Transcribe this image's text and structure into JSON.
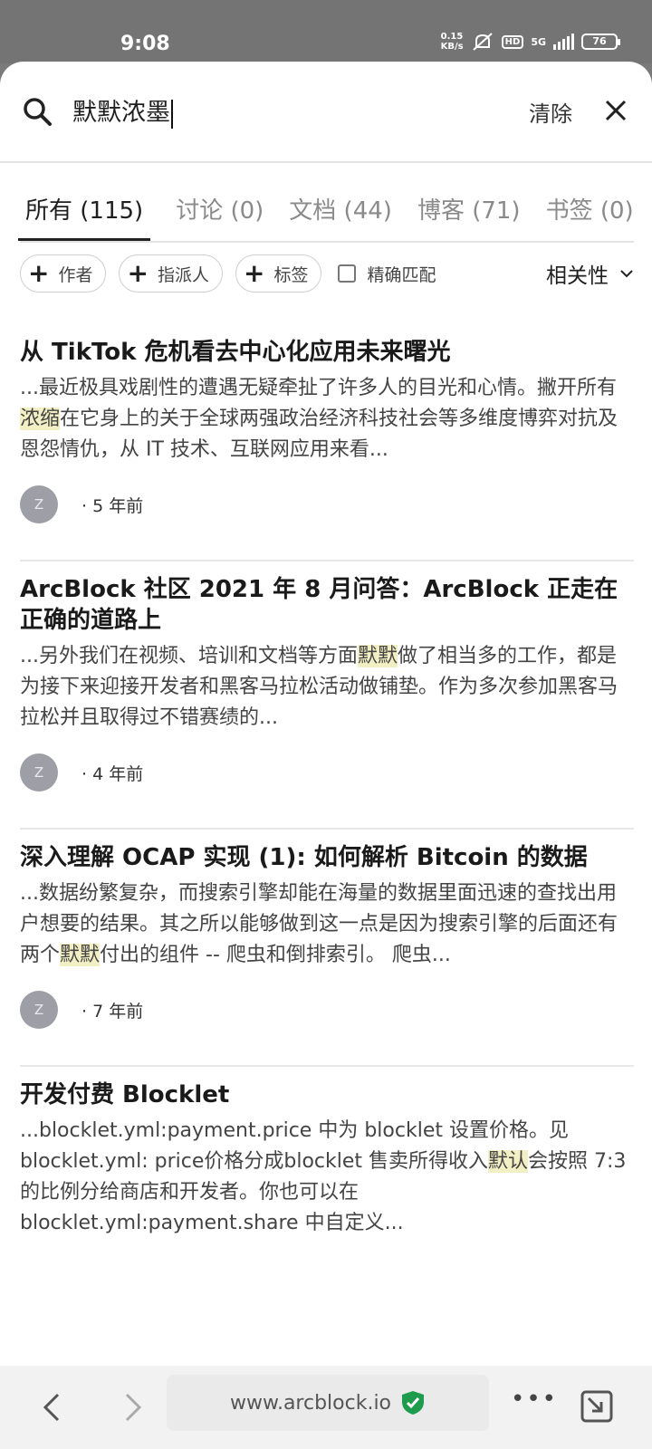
{
  "status_bar": {
    "time": "9:08",
    "speed_value": "0.15",
    "speed_unit": "KB/s",
    "hd": "HD",
    "network": "5G",
    "battery": "76"
  },
  "search": {
    "query": "默默浓墨",
    "clear_label": "清除"
  },
  "tabs": [
    {
      "label": "所有 (115)",
      "active": true
    },
    {
      "label": "讨论 (0)",
      "active": false
    },
    {
      "label": "文档 (44)",
      "active": false
    },
    {
      "label": "博客 (71)",
      "active": false
    },
    {
      "label": "书签 (0)",
      "active": false
    }
  ],
  "filters": {
    "author": "作者",
    "assignee": "指派人",
    "tags": "标签",
    "exact_match": "精确匹配",
    "sort": "相关性"
  },
  "results": [
    {
      "title": "从 TikTok 危机看去中心化应用未来曙光",
      "snippet_before": "...最近极具戏剧性的遭遇无疑牵扯了许多人的目光和心情。撇开所有",
      "highlight": "浓缩",
      "snippet_after": "在它身上的关于全球两强政治经济科技社会等多维度博弈对抗及恩怨情仇，从 IT 技术、互联网应用来看...",
      "avatar": "Z",
      "time": "· 5 年前"
    },
    {
      "title": "ArcBlock 社区 2021 年 8 月问答：ArcBlock 正走在正确的道路上",
      "snippet_before": "...另外我们在视频、培训和文档等方面",
      "highlight": "默默",
      "snippet_after": "做了相当多的工作，都是为接下来迎接开发者和黑客马拉松活动做铺垫。作为多次参加黑客马拉松并且取得过不错赛绩的...",
      "avatar": "Z",
      "time": "· 4 年前"
    },
    {
      "title": "深入理解 OCAP 实现 (1): 如何解析 Bitcoin 的数据",
      "snippet_before": "...数据纷繁复杂，而搜索引擎却能在海量的数据里面迅速的查找出用户想要的结果。其之所以能够做到这一点是因为搜索引擎的后面还有两个",
      "highlight": "默默",
      "snippet_after": "付出的组件 -- 爬虫和倒排索引。 爬虫...",
      "avatar": "Z",
      "time": "· 7 年前"
    },
    {
      "title": "开发付费 Blocklet",
      "snippet_before": "...blocklet.yml:payment.price 中为 blocklet 设置价格。见 blocklet.yml: price价格分成blocklet 售卖所得收入",
      "highlight": "默认",
      "snippet_after": "会按照 7:3 的比例分给商店和开发者。你也可以在 blocklet.yml:payment.share 中自定义...",
      "avatar": "",
      "time": ""
    }
  ],
  "browser": {
    "url": "www.arcblock.io"
  }
}
